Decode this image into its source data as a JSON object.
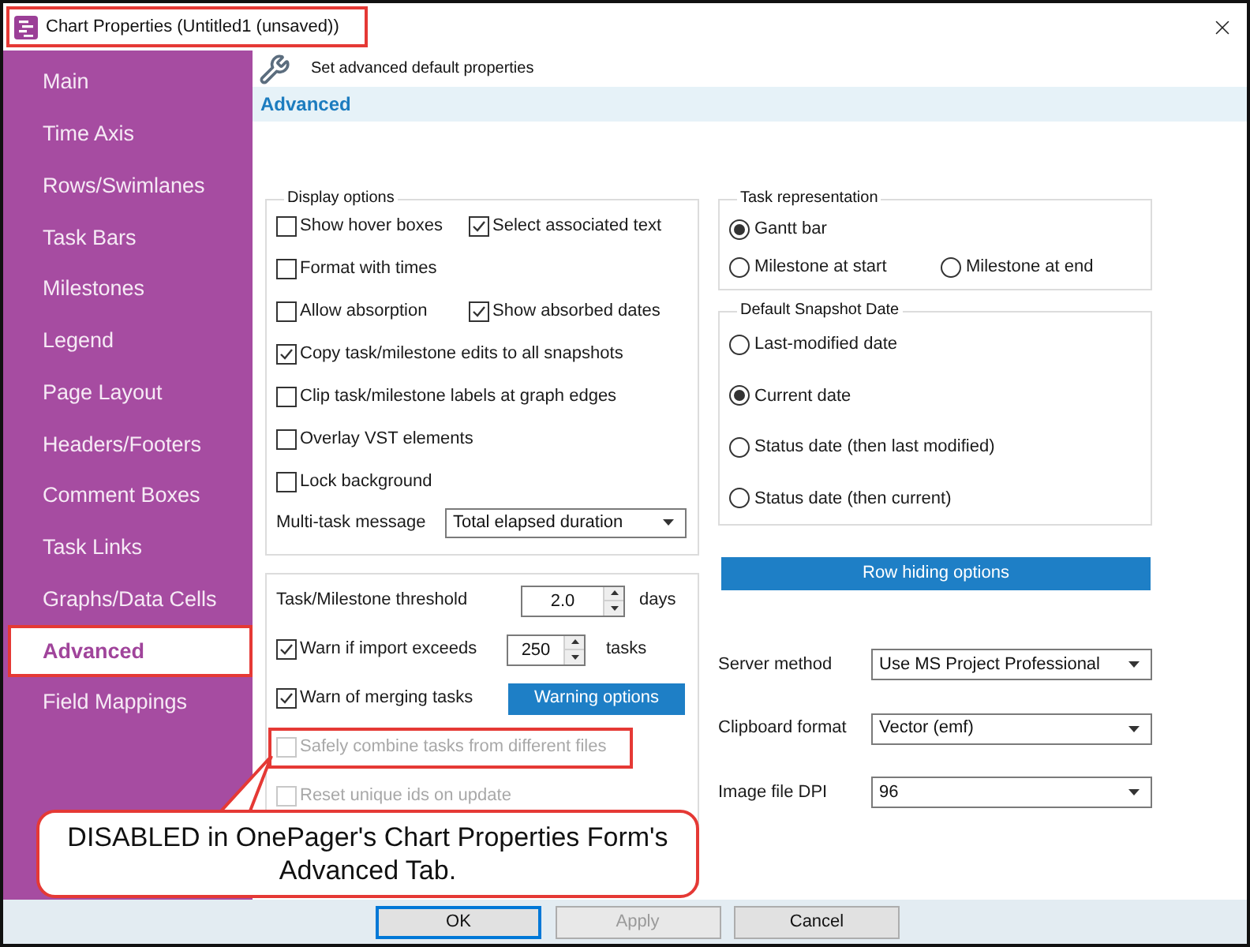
{
  "window": {
    "title": "Chart Properties (Untitled1 (unsaved))",
    "highlighted": true
  },
  "sidebar": {
    "items": [
      {
        "label": "Main",
        "selected": false
      },
      {
        "label": "Time Axis",
        "selected": false
      },
      {
        "label": "Rows/Swimlanes",
        "selected": false
      },
      {
        "label": "Task Bars",
        "selected": false
      },
      {
        "label": "Milestones",
        "selected": false
      },
      {
        "label": "Legend",
        "selected": false
      },
      {
        "label": "Page Layout",
        "selected": false
      },
      {
        "label": "Headers/Footers",
        "selected": false
      },
      {
        "label": "Comment Boxes",
        "selected": false
      },
      {
        "label": "Task Links",
        "selected": false
      },
      {
        "label": "Graphs/Data Cells",
        "selected": false
      },
      {
        "label": "Advanced",
        "selected": true
      },
      {
        "label": "Field Mappings",
        "selected": false
      }
    ]
  },
  "header": {
    "text": "Set advanced default properties"
  },
  "section": {
    "title": "Advanced"
  },
  "display_options": {
    "title": "Display options",
    "rows": [
      {
        "items": [
          {
            "label": "Show hover boxes",
            "checked": false
          },
          {
            "label": "Select associated text",
            "checked": true
          }
        ]
      },
      {
        "items": [
          {
            "label": "Format with times",
            "checked": false
          }
        ]
      },
      {
        "items": [
          {
            "label": "Allow absorption",
            "checked": false
          },
          {
            "label": "Show absorbed dates",
            "checked": true
          }
        ]
      },
      {
        "items": [
          {
            "label": "Copy task/milestone edits to all snapshots",
            "checked": true
          }
        ]
      },
      {
        "items": [
          {
            "label": "Clip task/milestone labels at graph edges",
            "checked": false
          }
        ]
      },
      {
        "items": [
          {
            "label": "Overlay VST elements",
            "checked": false
          }
        ]
      },
      {
        "items": [
          {
            "label": "Lock background",
            "checked": false
          }
        ]
      }
    ],
    "multi_task_message": {
      "label": "Multi-task message",
      "value": "Total elapsed duration"
    }
  },
  "import_options": {
    "items": [
      {
        "kind": "spin",
        "label": "Task/Milestone threshold",
        "value": "2.0",
        "unit": "days",
        "disabled": false,
        "highlighted": false
      },
      {
        "kind": "check_spin",
        "label": "Warn if import exceeds",
        "checked": true,
        "value": "250",
        "unit": "tasks",
        "disabled": false,
        "highlighted": false
      },
      {
        "kind": "check_button",
        "label": "Warn of merging tasks",
        "checked": true,
        "button": "Warning options",
        "disabled": false,
        "highlighted": false
      },
      {
        "kind": "check",
        "label": "Safely combine tasks from different files",
        "checked": false,
        "disabled": true,
        "highlighted": true
      },
      {
        "kind": "check",
        "label": "Reset unique ids on update",
        "checked": false,
        "disabled": true,
        "highlighted": false
      }
    ]
  },
  "task_representation": {
    "title": "Task representation",
    "rows": [
      {
        "options": [
          {
            "label": "Gantt bar",
            "selected": true
          }
        ]
      },
      {
        "options": [
          {
            "label": "Milestone at start",
            "selected": false
          },
          {
            "label": "Milestone at end",
            "selected": false
          }
        ]
      }
    ]
  },
  "snapshot_date": {
    "title": "Default Snapshot Date",
    "options": [
      {
        "label": "Last-modified date",
        "selected": false
      },
      {
        "label": "Current date",
        "selected": true
      },
      {
        "label": "Status date (then last modified)",
        "selected": false
      },
      {
        "label": "Status date (then current)",
        "selected": false
      }
    ]
  },
  "row_hiding_button": {
    "label": "Row hiding options"
  },
  "settings": [
    {
      "label": "Server method",
      "value": "Use MS Project Professional"
    },
    {
      "label": "Clipboard format",
      "value": "Vector (emf)"
    },
    {
      "label": "Image file DPI",
      "value": "96"
    }
  ],
  "callout": {
    "text": "DISABLED in OnePager's Chart Properties Form's Advanced Tab."
  },
  "buttons": [
    {
      "label": "OK",
      "default": true,
      "disabled": false
    },
    {
      "label": "Apply",
      "default": false,
      "disabled": true
    },
    {
      "label": "Cancel",
      "default": false,
      "disabled": false
    }
  ]
}
